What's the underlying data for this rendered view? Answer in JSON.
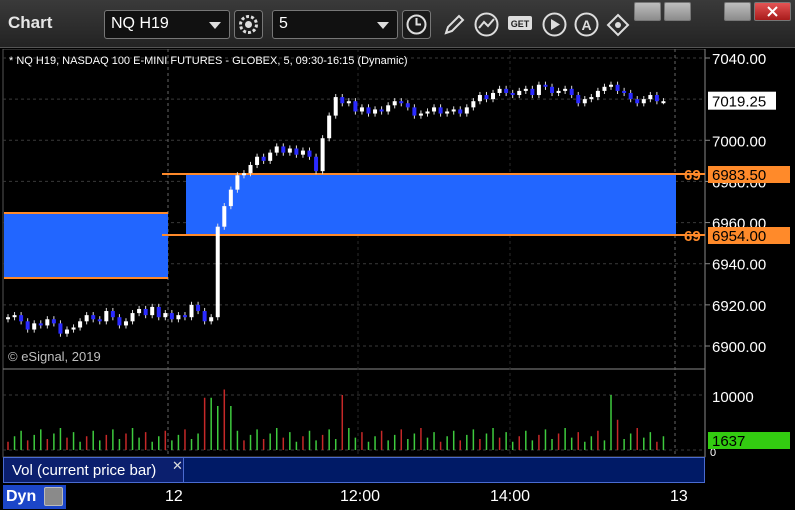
{
  "window": {
    "title": "Chart",
    "symbol": "NQ H19",
    "interval": "5"
  },
  "chart": {
    "description": "* NQ H19, NASDAQ 100 E-MINI FUTURES - GLOBEX, 5, 09:30-16:15 (Dynamic)",
    "copyright": "© eSignal, 2019",
    "current_price_label": "7019.25",
    "levels": [
      {
        "tag": "69",
        "value": "6983.50"
      },
      {
        "tag": "69",
        "value": "6954.00"
      }
    ],
    "y_ticks": [
      "7040.00",
      "7000.00",
      "6980.00",
      "6960.00",
      "6940.00",
      "6920.00",
      "6900.00"
    ],
    "volume_ticks": [
      "10000",
      "0"
    ],
    "volume_current": "1637",
    "volume_panel_label": "Vol (current price bar)",
    "dyn_label": "Dyn",
    "x_ticks": [
      "12",
      "12:00",
      "14:00",
      "13"
    ]
  },
  "colors": {
    "zone_fill": "#2266ff",
    "level_line": "#ff8a2a",
    "up_candle": "#ffffff",
    "down_candle": "#2a2aff",
    "volume_up": "#3ecb3e",
    "volume_down": "#c62828",
    "volume_badge": "#33cc11"
  },
  "icons": [
    "gear-icon",
    "clock-icon",
    "pencil-icon",
    "indicator-icon",
    "get-icon",
    "play-icon",
    "alert-icon",
    "cursor-icon"
  ]
}
